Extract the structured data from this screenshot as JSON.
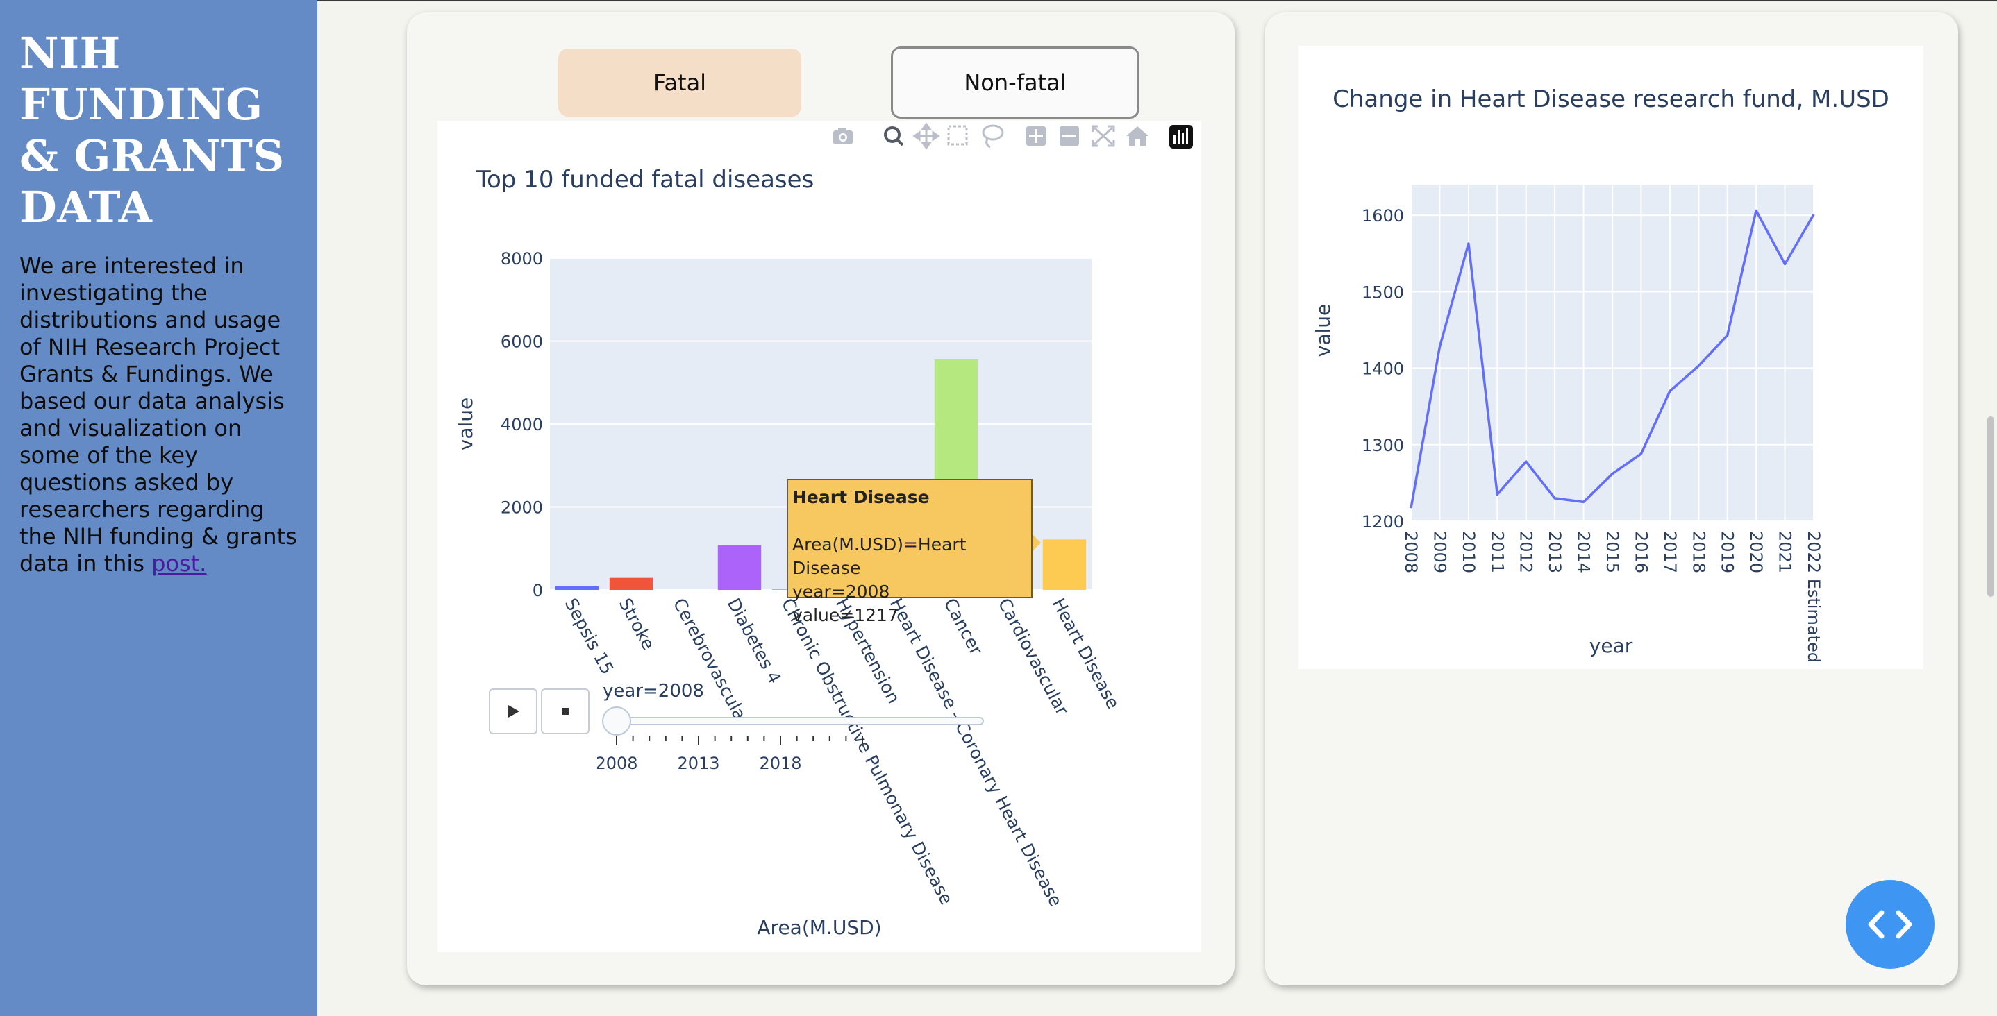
{
  "sidebar": {
    "title": "NIH FUNDING & GRANTS DATA",
    "intro": "We are interested in investigating the distributions and usage of NIH Research Project Grants & Fundings. We based our data analysis and visualization on some of the key questions asked by researchers regarding the NIH funding & grants data in this ",
    "link_text": "post."
  },
  "tabs": {
    "fatal": "Fatal",
    "nonfatal": "Non-fatal"
  },
  "toolbar": [
    "camera-icon",
    "zoom-icon",
    "pan-icon",
    "box-select-icon",
    "lasso-icon",
    "zoom-in-icon",
    "zoom-out-icon",
    "autoscale-icon",
    "reset-axes-icon",
    "plotly-logo-icon"
  ],
  "tooltip": {
    "title": "Heart Disease",
    "line1": "Area(M.USD)=Heart Disease",
    "line2": "year=2008",
    "line3": "value=1217"
  },
  "slider": {
    "current_label": "year=2008",
    "ticks": [
      "2008",
      "2013",
      "2018"
    ]
  },
  "colors": {
    "sidebar": "#658bc6",
    "fatal_tab": "#f5dec8",
    "line": "#636efa",
    "tooltip": "#f7c85f",
    "fab": "#3f96f2"
  },
  "chart_data": [
    {
      "type": "bar",
      "title": "Top 10 funded fatal diseases",
      "xlabel": "Area(M.USD)",
      "ylabel": "value",
      "ylim": [
        0,
        8000
      ],
      "yticks": [
        "0",
        "2000",
        "4000",
        "6000",
        "8000"
      ],
      "categories": [
        "Sepsis 15",
        "Stroke",
        "Cerebrovascular",
        "Diabetes 4",
        "Chronic Obstructive Pulmonary Disease",
        "Hypertension",
        "Heart Disease - Coronary Heart Disease",
        "Cancer",
        "Cardiovascular",
        "Heart Disease"
      ],
      "values": [
        85,
        290,
        0,
        1080,
        30,
        0,
        0,
        5560,
        0,
        1217
      ],
      "colors": [
        "#636efa",
        "#ef553b",
        "#00cc96",
        "#ab63fa",
        "#ffa15a",
        "#19d3f3",
        "#ff6692",
        "#b6e880",
        "#ff97ff",
        "#fecb52"
      ],
      "grid": true,
      "legend": "none"
    },
    {
      "type": "line",
      "title": "Change in Heart Disease  research fund, M.USD",
      "xlabel": "year",
      "ylabel": "value",
      "ylim": [
        1200,
        1640
      ],
      "yticks": [
        "1200",
        "1300",
        "1400",
        "1500",
        "1600"
      ],
      "x": [
        "2008",
        "2009",
        "2010",
        "2011",
        "2012",
        "2013",
        "2014",
        "2015",
        "2016",
        "2017",
        "2018",
        "2019",
        "2020",
        "2021",
        "2022 Estimated"
      ],
      "values": [
        1217,
        1428,
        1563,
        1235,
        1278,
        1230,
        1225,
        1262,
        1288,
        1370,
        1403,
        1443,
        1606,
        1536,
        1601
      ],
      "grid": true,
      "legend": "none"
    }
  ]
}
